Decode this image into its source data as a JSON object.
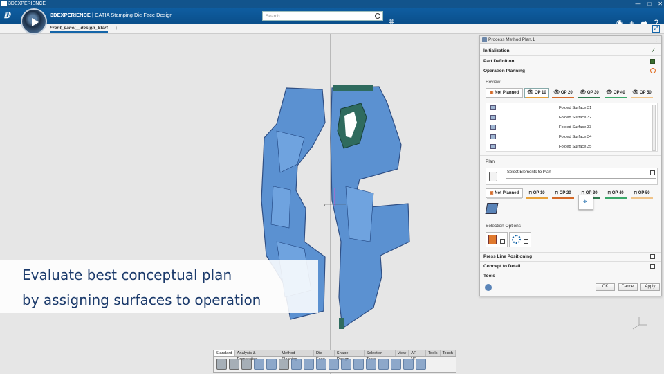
{
  "titlebar": {
    "title": "3DEXPERIENCE",
    "min": "—",
    "max": "□",
    "close": "✕"
  },
  "header": {
    "app_brand": "3DEXPERIENCE",
    "app_name": " | CATIA Stamping Die Face Design",
    "search_placeholder": "Search"
  },
  "tabs": {
    "active": "Front_panel__design_Start",
    "add": "+"
  },
  "panel": {
    "title": "Process Method Plan.1",
    "sections": {
      "initialization": "Initialization",
      "part_definition": "Part Definition",
      "operation_planning": "Operation Planning",
      "press_line": "Press Line Positioning",
      "concept_detail": "Concept to Detail",
      "tools": "Tools"
    },
    "review_label": "Review",
    "review_ops": [
      "Not Planned",
      "OP 10",
      "OP 20",
      "OP 30",
      "OP 40",
      "OP 50"
    ],
    "op_colors": [
      "#ffffff",
      "#e8a23a",
      "#d46a28",
      "#2e7a4f",
      "#3aa86a",
      "#f0c48a"
    ],
    "list_items": [
      "Folded Surface.31",
      "Folded Surface.32",
      "Folded Surface.33",
      "Folded Surface.34",
      "Folded Surface.35"
    ],
    "plan_label": "Plan",
    "select_elements": "Select Elements to Plan",
    "plan_ops": [
      "Not Planned",
      "OP 10",
      "OP 20",
      "OP 30",
      "OP 40",
      "OP 50"
    ],
    "selection_options": "Selection Options",
    "buttons": {
      "ok": "OK",
      "cancel": "Cancel",
      "apply": "Apply"
    }
  },
  "caption": {
    "line1": "Evaluate best conceptual plan",
    "line2": "by assigning surfaces to operation"
  },
  "toolbar_tabs": [
    "Standard",
    "Analysis & Preparation",
    "Method Planning",
    "Die Face",
    "Shape Design",
    "Selection Tools",
    "View",
    "AR-VR",
    "Tools",
    "Touch"
  ],
  "accent": "#1465a8"
}
